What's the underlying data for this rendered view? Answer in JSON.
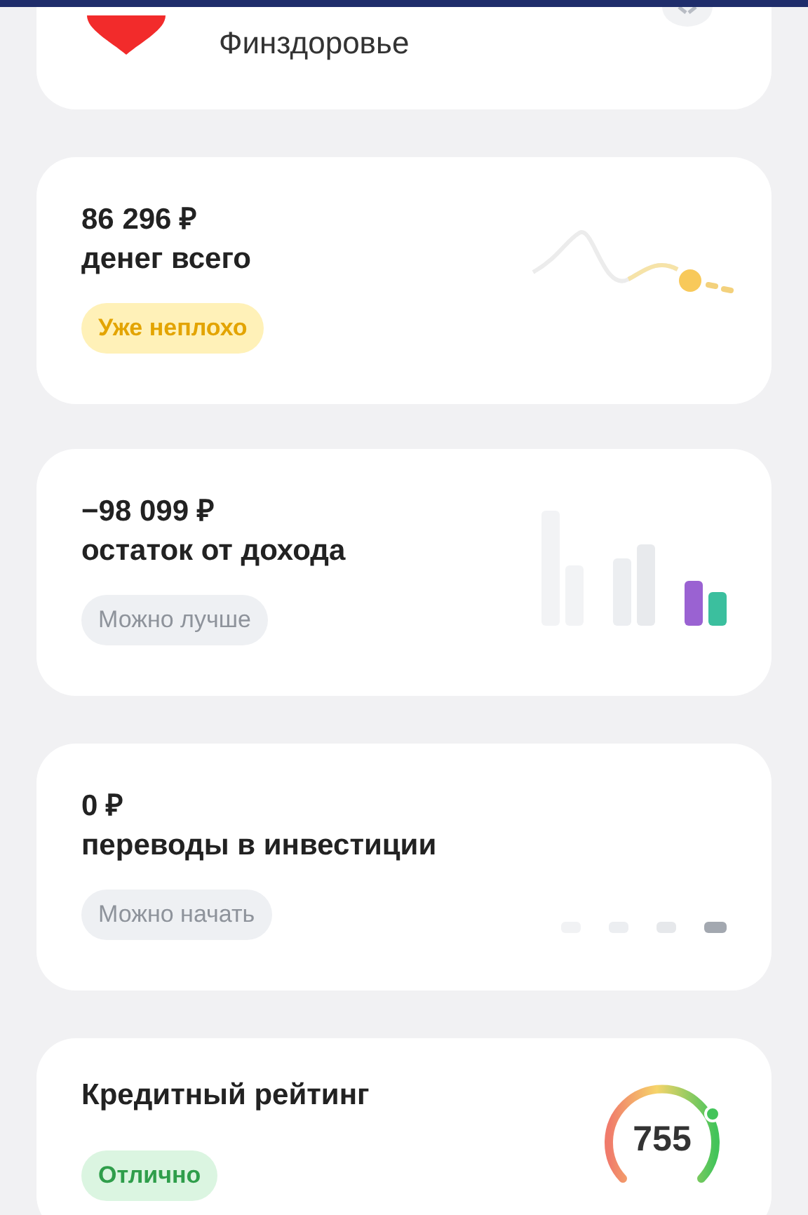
{
  "banner": {
    "text": "Финздоровье"
  },
  "cards": [
    {
      "kind": "wave",
      "amount": "86 296 ₽",
      "label": "денег всего",
      "tag": {
        "text": "Уже неплохо",
        "kind": "warning"
      }
    },
    {
      "kind": "bars",
      "amount": "−98 099 ₽",
      "label": "остаток от дохода",
      "tag": {
        "text": "Можно лучше",
        "kind": "neutral"
      }
    },
    {
      "kind": "dots",
      "amount": "0 ₽",
      "label": "переводы в инвестиции",
      "tag": {
        "text": "Можно начать",
        "kind": "neutral"
      }
    },
    {
      "kind": "gauge",
      "label": "Кредитный рейтинг",
      "score": "755",
      "tag": {
        "text": "Отлично",
        "kind": "success"
      }
    }
  ]
}
